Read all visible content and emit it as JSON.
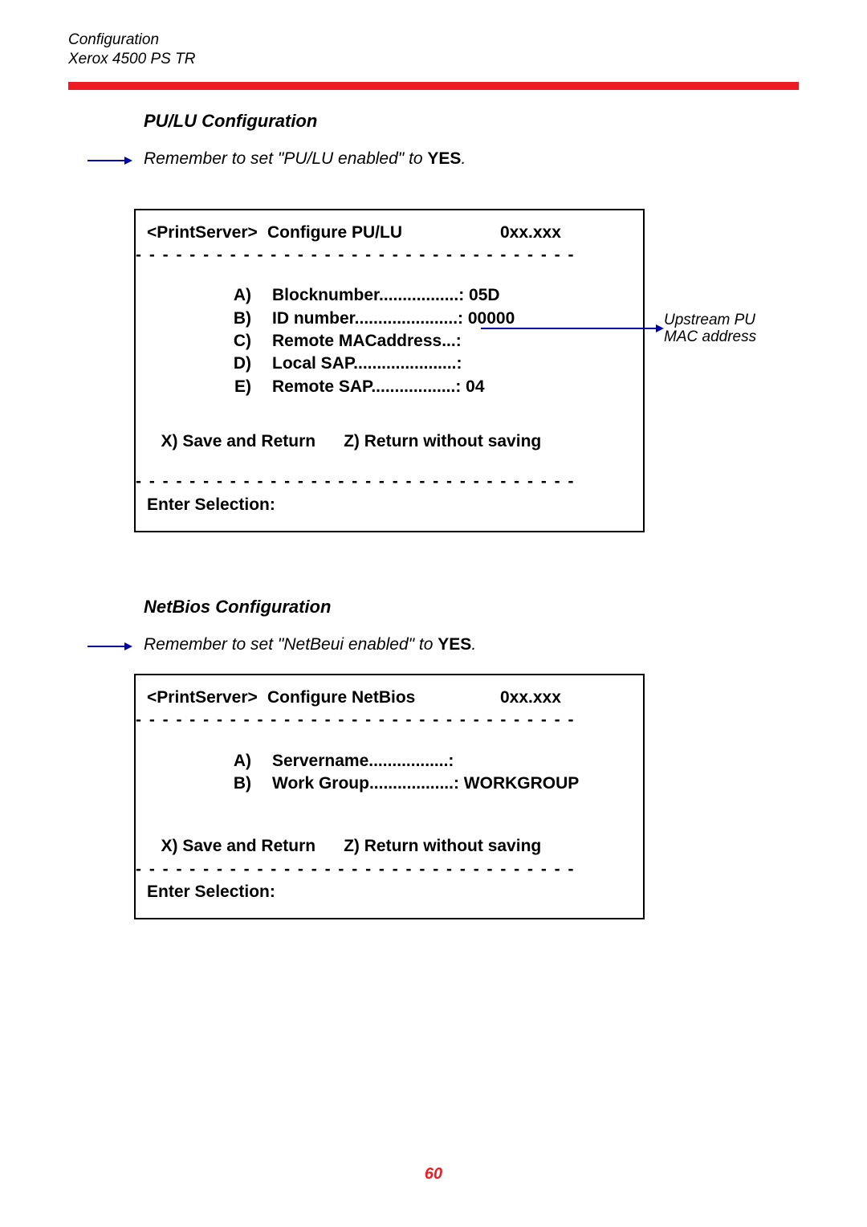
{
  "header": {
    "line1": "Configuration",
    "line2": "Xerox 4500 PS TR"
  },
  "section1": {
    "title": "PU/LU Configuration",
    "note_prefix": "Remember to set \"PU/LU enabled\" to ",
    "note_yes": "YES",
    "note_suffix": "."
  },
  "screen1": {
    "hdr_left": "<PrintServer>",
    "hdr_mid": "Configure PU/LU",
    "hdr_right": "0xx.xxx",
    "sep": "- - - - - - - - - - - - - - - - - - - - - - - - - - - - - - - - -",
    "opts": [
      {
        "letter": "A)",
        "text": "Blocknumber.................: 05D"
      },
      {
        "letter": "B)",
        "text": "ID number......................: 00000"
      },
      {
        "letter": "C)",
        "text": "Remote MACaddress...:"
      },
      {
        "letter": "D)",
        "text": "Local SAP......................:"
      },
      {
        "letter": "E)",
        "text": "Remote SAP..................: 04"
      }
    ],
    "foot": "X) Save and Return      Z) Return without saving",
    "enter": "Enter Selection:"
  },
  "annotation1": {
    "line1": "Upstream PU",
    "line2": "MAC address"
  },
  "section2": {
    "title": "NetBios Configuration",
    "note_prefix": "Remember to set \"NetBeui enabled\" to ",
    "note_yes": "YES",
    "note_suffix": "."
  },
  "screen2": {
    "hdr_left": "<PrintServer>",
    "hdr_mid": "Configure NetBios",
    "hdr_right": "0xx.xxx",
    "sep": "- - - - - - - - - - - - - - - - - - - - - - - - - - - - - - - - -",
    "opts": [
      {
        "letter": "A)",
        "text": "Servername.................:"
      },
      {
        "letter": "B)",
        "text": "Work Group..................: WORKGROUP"
      }
    ],
    "foot": "X) Save and Return      Z) Return without saving",
    "enter": "Enter Selection:"
  },
  "page_number": "60"
}
